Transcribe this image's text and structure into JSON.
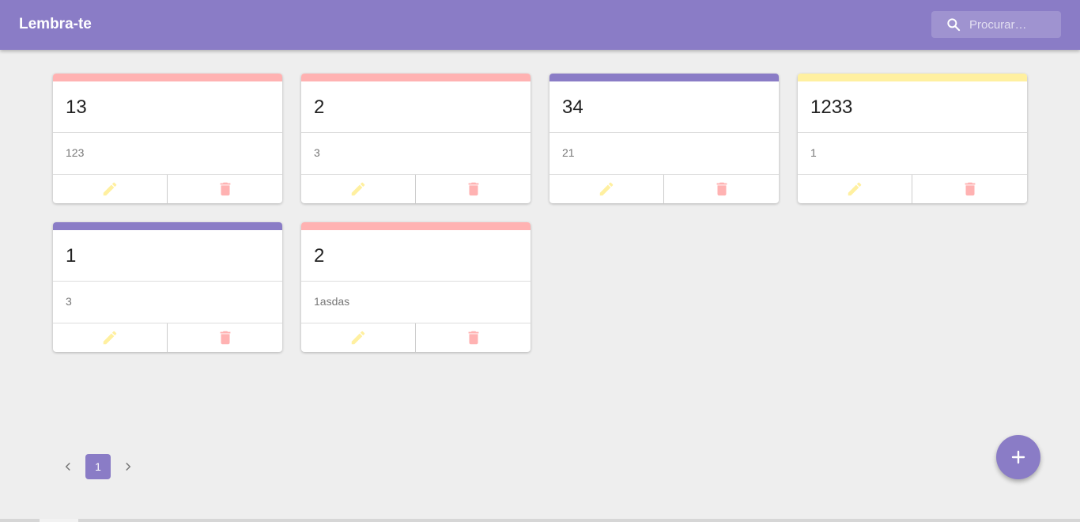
{
  "app": {
    "title": "Lembra-te"
  },
  "search": {
    "placeholder": "Procurar…",
    "value": "",
    "icon": "search-icon"
  },
  "colors": {
    "primary": "#8a7cc6",
    "pink": "#ffb2b2",
    "purple": "#8a7cc6",
    "yellow": "#fff0a0",
    "edit_icon": "#fff0a0",
    "delete_icon": "#ffb2b2",
    "background": "#eeeeee"
  },
  "notes": [
    {
      "title": "13",
      "body": "123",
      "color": "#ffb2b2"
    },
    {
      "title": "2",
      "body": "3",
      "color": "#ffb2b2"
    },
    {
      "title": "34",
      "body": "21",
      "color": "#8a7cc6"
    },
    {
      "title": "1233",
      "body": "1",
      "color": "#fff0a0"
    },
    {
      "title": "1",
      "body": "3",
      "color": "#8a7cc6"
    },
    {
      "title": "2",
      "body": "1asdas",
      "color": "#ffb2b2"
    }
  ],
  "note_actions": {
    "edit_icon": "pencil-icon",
    "delete_icon": "trash-icon"
  },
  "pagination": {
    "current_page": "1",
    "prev_icon": "chevron-left-icon",
    "next_icon": "chevron-right-icon"
  },
  "fab": {
    "icon": "plus-icon"
  }
}
